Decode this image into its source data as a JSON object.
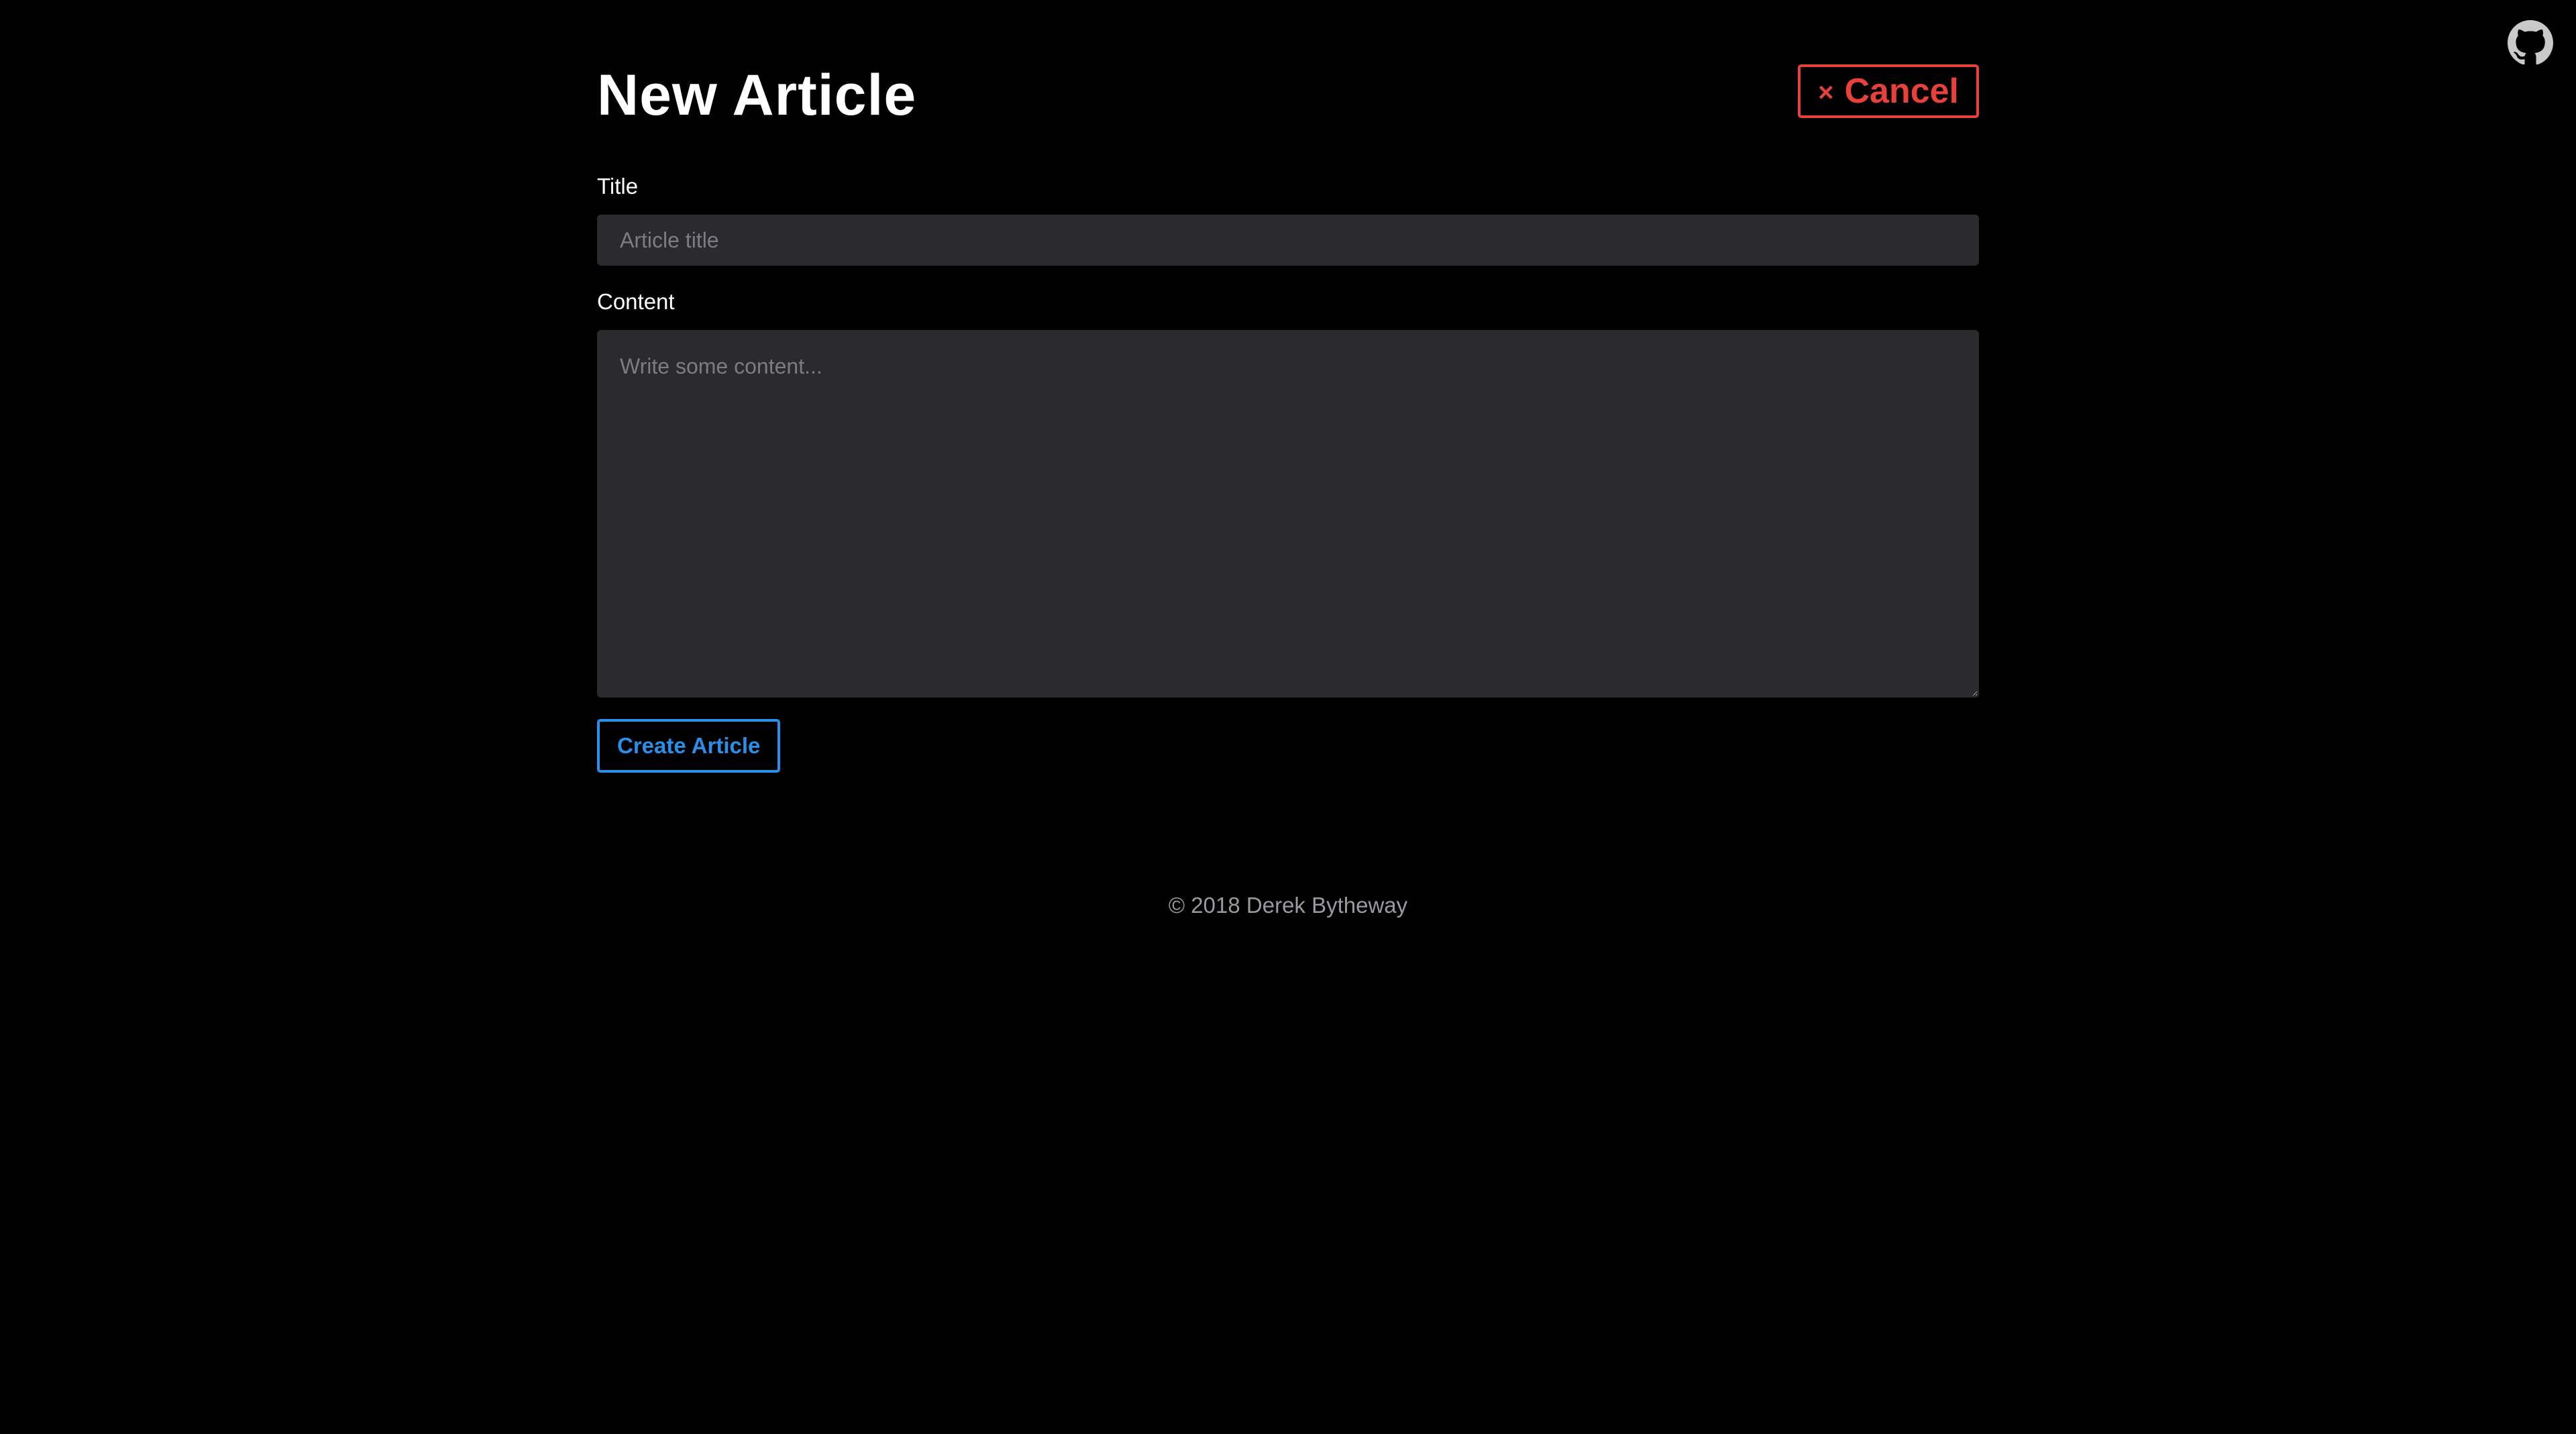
{
  "header": {
    "title": "New Article",
    "cancel_icon": "×",
    "cancel_label": "Cancel",
    "github_icon": "github-icon"
  },
  "form": {
    "title_label": "Title",
    "title_placeholder": "Article title",
    "title_value": "",
    "content_label": "Content",
    "content_placeholder": "Write some content...",
    "content_value": "",
    "submit_label": "Create Article"
  },
  "footer": {
    "copyright": "© 2018 Derek Bytheway"
  },
  "colors": {
    "background": "#000000",
    "input_background": "#2a2a2f",
    "cancel": "#e8413c",
    "primary": "#2a8fe8",
    "muted_text": "#9a9aa0"
  }
}
